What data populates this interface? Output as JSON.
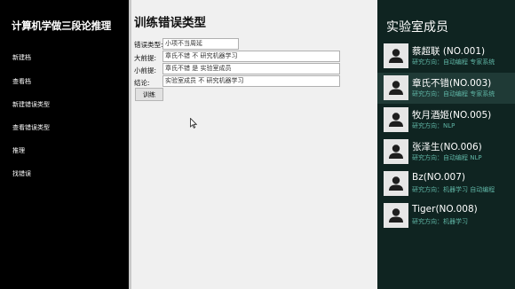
{
  "app_title": "计算机学做三段论推理",
  "nav": [
    {
      "label": "新建档"
    },
    {
      "label": "查看档"
    },
    {
      "label": "新建错误类型"
    },
    {
      "label": "查看错误类型"
    },
    {
      "label": "推理"
    },
    {
      "label": "找错误"
    }
  ],
  "main": {
    "title": "训练错误类型",
    "fields": [
      {
        "label": "错误类型:",
        "value": "小项不当周延"
      },
      {
        "label": "大前提:",
        "value": "章氏不错 不 研究机器学习"
      },
      {
        "label": "小前提:",
        "value": "章氏不错 是 实验室成员"
      },
      {
        "label": "结论:",
        "value": "实验室成员 不 研究机器学习"
      }
    ],
    "train_label": "训练"
  },
  "members_panel": {
    "title": "实验室成员",
    "members": [
      {
        "name": "蔡超联 (NO.001)",
        "direction": "研究方向：自动编程  专家系统",
        "selected": false
      },
      {
        "name": "章氏不错(NO.003)",
        "direction": "研究方向：自动编程  专家系统",
        "selected": true
      },
      {
        "name": "牧月酒姬(NO.005)",
        "direction": "研究方向：NLP",
        "selected": false
      },
      {
        "name": "张泽生(NO.006)",
        "direction": "研究方向：自动编程    NLP",
        "selected": false
      },
      {
        "name": "Bz(NO.007)",
        "direction": "研究方向：机器学习  自动编程",
        "selected": false
      },
      {
        "name": "Tiger(NO.008)",
        "direction": "研究方向：机器学习",
        "selected": false
      }
    ]
  }
}
